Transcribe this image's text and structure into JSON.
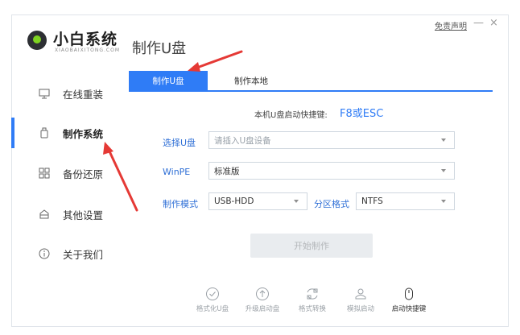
{
  "brand": {
    "name": "小白系统",
    "subtitle": "XIAOBAIXITONG.COM"
  },
  "page_title": "制作U盘",
  "window": {
    "disclaimer": "免责声明",
    "minimize": "—",
    "close": "×"
  },
  "sidebar": {
    "items": [
      {
        "label": "在线重装",
        "icon": "monitor-icon"
      },
      {
        "label": "制作系统",
        "icon": "usb-drive-icon",
        "active": true
      },
      {
        "label": "备份还原",
        "icon": "grid-icon"
      },
      {
        "label": "其他设置",
        "icon": "archive-icon"
      },
      {
        "label": "关于我们",
        "icon": "info-icon"
      }
    ]
  },
  "tabs": [
    {
      "label": "制作U盘",
      "active": true
    },
    {
      "label": "制作本地",
      "active": false
    }
  ],
  "hotkey": {
    "label": "本机U盘启动快捷键:",
    "value": "F8或ESC"
  },
  "form": {
    "select_usb": {
      "label": "选择U盘",
      "placeholder": "请插入U盘设备"
    },
    "winpe": {
      "label": "WinPE",
      "value": "标准版"
    },
    "mode": {
      "label": "制作模式",
      "value": "USB-HDD"
    },
    "partition": {
      "label": "分区格式",
      "value": "NTFS"
    }
  },
  "start_button": "开始制作",
  "bottom_tools": [
    {
      "label": "格式化U盘",
      "icon": "check-circle-icon"
    },
    {
      "label": "升级启动盘",
      "icon": "upload-icon"
    },
    {
      "label": "格式转换",
      "icon": "convert-icon"
    },
    {
      "label": "模拟启动",
      "icon": "person-icon"
    },
    {
      "label": "启动快捷键",
      "icon": "mouse-icon"
    }
  ],
  "colors": {
    "accent": "#2f7cf6",
    "arrow": "#e53935"
  }
}
